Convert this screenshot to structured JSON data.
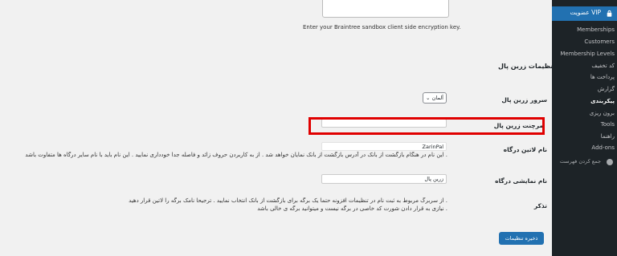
{
  "page": {
    "client_side_hint": "Enter your Braintree sandbox client side encryption key.",
    "section_title": "تنظیمات زرین پال",
    "server": {
      "label": "سرور زرین پال",
      "value": "آلمان"
    },
    "merchant": {
      "label": "مرچنت زرین پال",
      "value": ""
    },
    "gateway_latin": {
      "label": "نام لاتین درگاه",
      "value": "ZarinPal",
      "description": "این نام در هنگام بازگشت از بانک در آدرس بازگشت از بانک نمایان خواهد شد . از به کاربردن حروف زائد و فاصله جدا خودداری نمایید . این نام باید با نام سایر درگاه ها متفاوت باشد ."
    },
    "gateway_display": {
      "label": "نام نمایشی درگاه",
      "value": "زرین پال"
    },
    "note": {
      "label": "تذکر",
      "line1": "از سربرگ مربوط به ثبت نام در تنظیمات افزونه حتما یک برگه برای بازگشت از بانک انتخاب نمایید . ترجیحا نامک برگه را لاتین قرار دهید .",
      "line2": "نیازی به قرار دادن شورت کد خاصی در برگه نیست و میتوانید برگه ی خالی باشد ."
    },
    "save_label": "ذخیره تنظیمات"
  },
  "sidebar": {
    "header": "عضویت VIP",
    "items": [
      {
        "label": "Memberships"
      },
      {
        "label": "Customers"
      },
      {
        "label": "Membership Levels"
      },
      {
        "label": "کد تخفیف"
      },
      {
        "label": "پرداخت ها"
      },
      {
        "label": "گزارش"
      },
      {
        "label": "پیکربندی"
      },
      {
        "label": "برون ریزی"
      },
      {
        "label": "Tools"
      },
      {
        "label": "راهنما"
      },
      {
        "label": "Add-ons"
      }
    ],
    "collapse_label": "جمع کردن فهرست"
  },
  "colors": {
    "accent": "#2271b1",
    "sidebar_bg": "#1d2327",
    "highlight": "#e00000"
  }
}
